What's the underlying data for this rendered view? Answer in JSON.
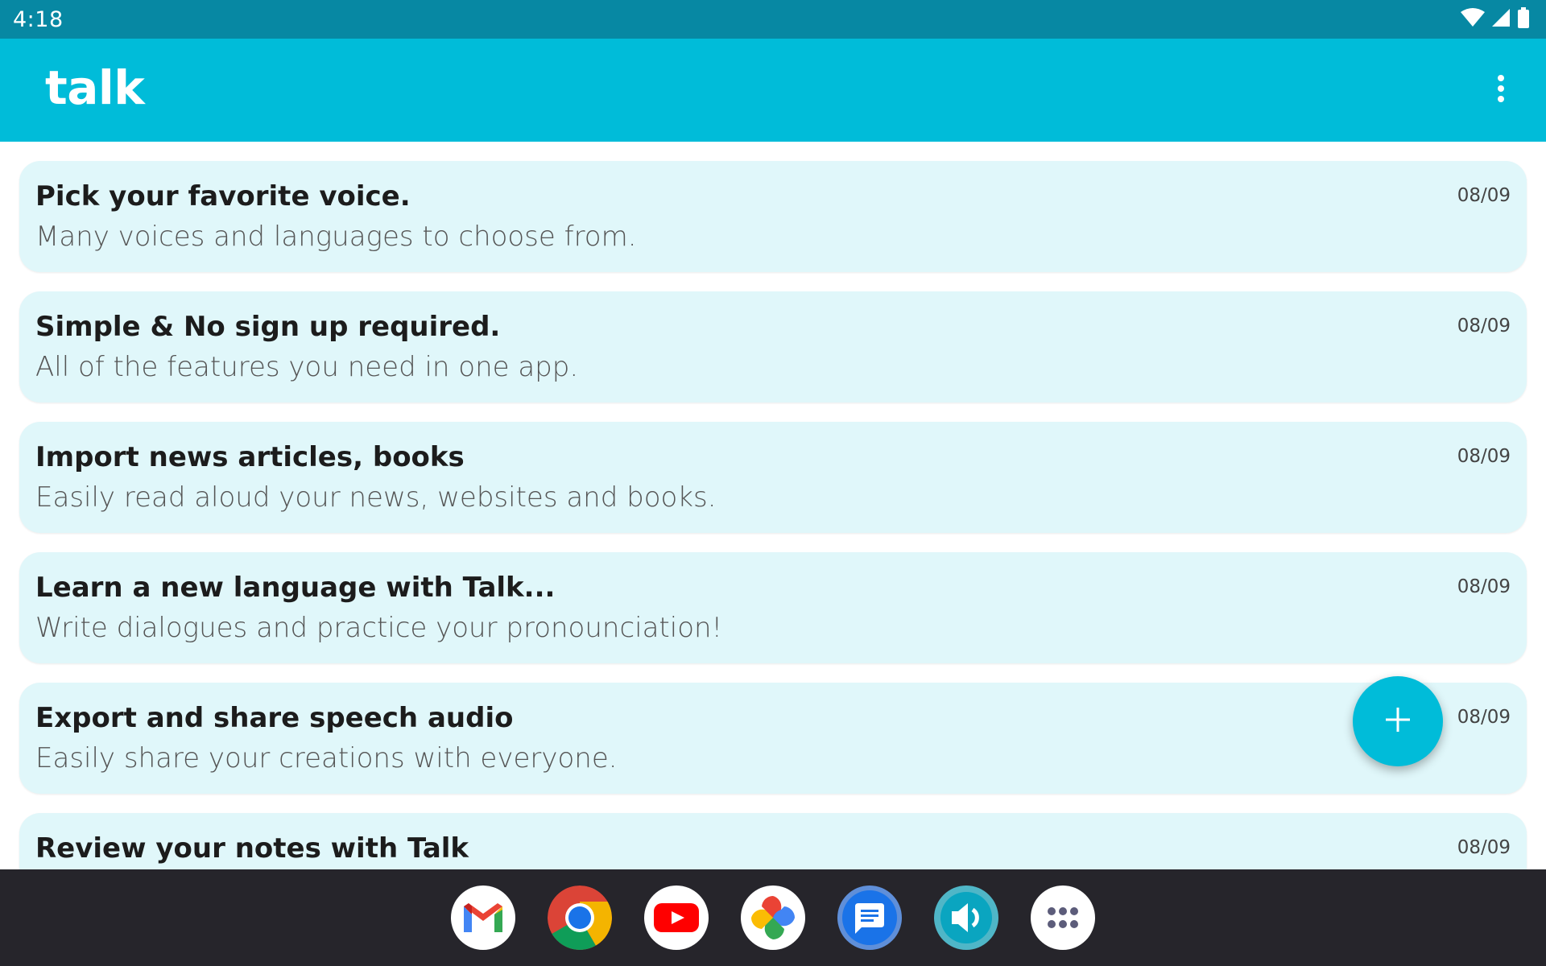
{
  "status_bar": {
    "time": "4:18",
    "icons": [
      "wifi-icon",
      "signal-icon",
      "battery-icon"
    ]
  },
  "app_bar": {
    "title": "talk",
    "menu_icon": "more-vert-icon"
  },
  "notes": [
    {
      "title": "Pick your favorite voice.",
      "subtitle": "Many voices and languages to choose from.",
      "date": "08/09"
    },
    {
      "title": "Simple & No sign up required.",
      "subtitle": "All of the features you need in one app.",
      "date": "08/09"
    },
    {
      "title": "Import news articles, books",
      "subtitle": "Easily read aloud your news, websites and books.",
      "date": "08/09"
    },
    {
      "title": "Learn a new language with Talk...",
      "subtitle": "Write dialogues and practice your pronounciation!",
      "date": "08/09"
    },
    {
      "title": "Export and share speech audio",
      "subtitle": "Easily share your creations with everyone.",
      "date": "08/09"
    },
    {
      "title": "Review your notes with Talk",
      "subtitle": "",
      "date": "08/09"
    }
  ],
  "fab": {
    "icon": "plus-icon"
  },
  "dock": {
    "apps": [
      "gmail-icon",
      "chrome-icon",
      "youtube-icon",
      "photos-icon",
      "messages-icon",
      "talk-app-icon",
      "app-drawer-icon"
    ]
  },
  "colors": {
    "status_bar": "#0788a3",
    "app_bar": "#00bcd9",
    "card": "#e0f7fa",
    "fab": "#00bcd9",
    "dock": "#26252b"
  }
}
